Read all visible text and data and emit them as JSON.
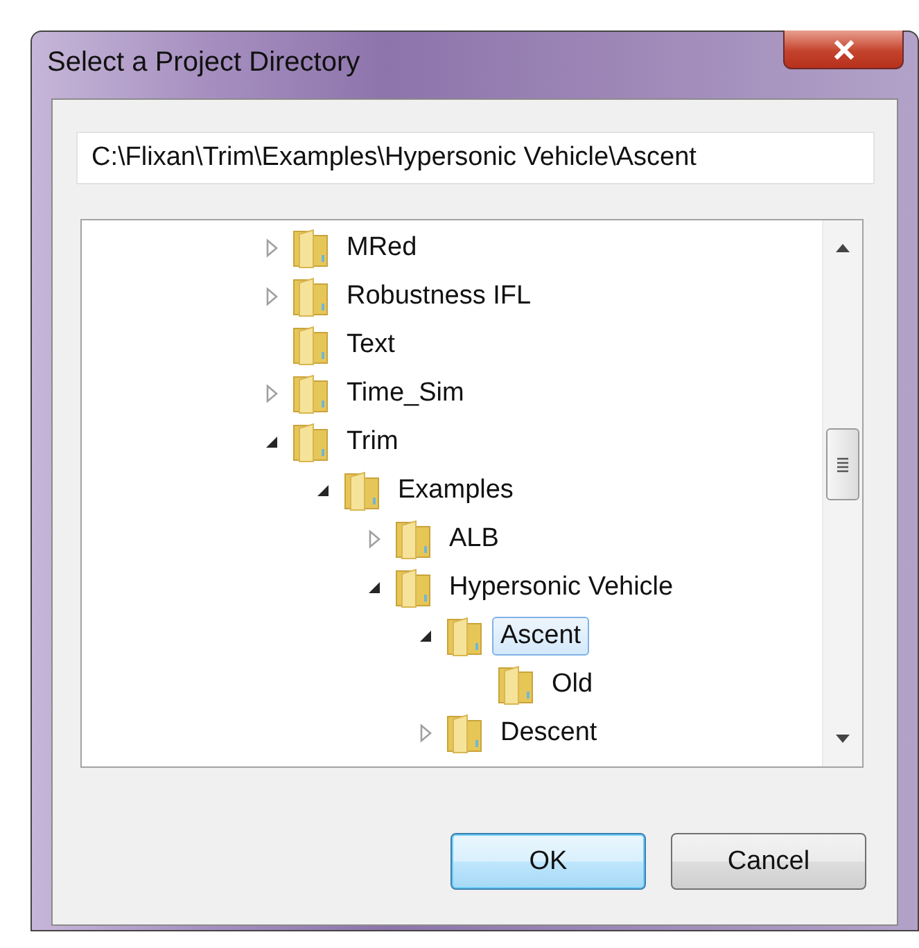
{
  "window": {
    "title": "Select a Project Directory"
  },
  "path_field": {
    "value": "C:\\Flixan\\Trim\\Examples\\Hypersonic Vehicle\\Ascent"
  },
  "tree": [
    {
      "label": "MRed",
      "has_children": true,
      "expanded": false,
      "selected": false
    },
    {
      "label": "Robustness IFL",
      "has_children": true,
      "expanded": false,
      "selected": false
    },
    {
      "label": "Text",
      "has_children": false,
      "selected": false
    },
    {
      "label": "Time_Sim",
      "has_children": true,
      "expanded": false,
      "selected": false
    },
    {
      "label": "Trim",
      "has_children": true,
      "expanded": true,
      "selected": false,
      "children": [
        {
          "label": "Examples",
          "has_children": true,
          "expanded": true,
          "selected": false,
          "children": [
            {
              "label": "ALB",
              "has_children": true,
              "expanded": false,
              "selected": false
            },
            {
              "label": "Hypersonic Vehicle",
              "has_children": true,
              "expanded": true,
              "selected": false,
              "children": [
                {
                  "label": "Ascent",
                  "has_children": true,
                  "expanded": true,
                  "selected": true,
                  "children": [
                    {
                      "label": "Old",
                      "has_children": false,
                      "selected": false
                    }
                  ]
                },
                {
                  "label": "Descent",
                  "has_children": true,
                  "expanded": false,
                  "selected": false
                }
              ]
            }
          ]
        }
      ]
    }
  ],
  "buttons": [
    {
      "label": "OK",
      "kind": "default"
    },
    {
      "label": "Cancel",
      "kind": "normal"
    }
  ]
}
